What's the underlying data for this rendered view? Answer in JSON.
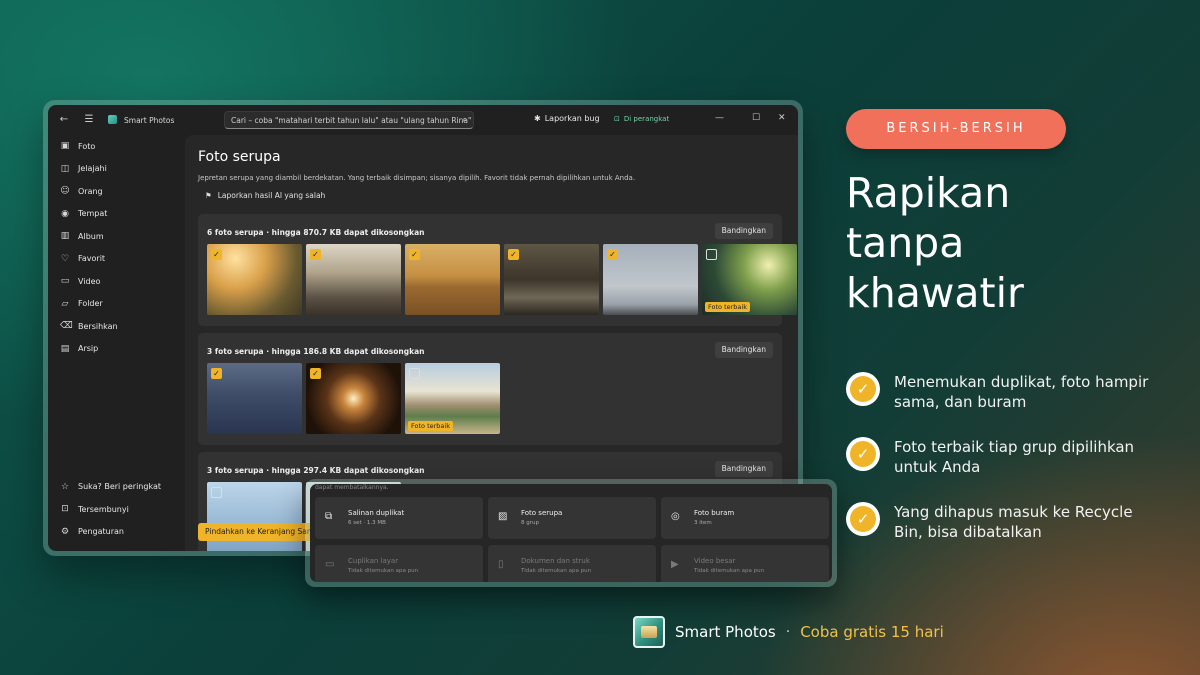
{
  "window": {
    "app_title": "Smart Photos",
    "search_placeholder": "Cari – coba \"matahari terbit tahun lalu\" atau \"ulang tahun Rina\"",
    "report_bug": "Laporkan bug",
    "device_status": "Di perangkat"
  },
  "sidebar": {
    "items": [
      {
        "label": "Foto",
        "icon": "photo-icon"
      },
      {
        "label": "Jelajahi",
        "icon": "explore-icon"
      },
      {
        "label": "Orang",
        "icon": "people-icon"
      },
      {
        "label": "Tempat",
        "icon": "place-icon"
      },
      {
        "label": "Album",
        "icon": "album-icon"
      },
      {
        "label": "Favorit",
        "icon": "heart-icon"
      },
      {
        "label": "Video",
        "icon": "video-icon"
      },
      {
        "label": "Folder",
        "icon": "folder-icon"
      },
      {
        "label": "Bersihkan",
        "icon": "trash-icon"
      },
      {
        "label": "Arsip",
        "icon": "archive-icon"
      }
    ],
    "bottom": [
      {
        "label": "Suka? Beri peringkat",
        "icon": "star-icon"
      },
      {
        "label": "Tersembunyi",
        "icon": "lock-icon"
      },
      {
        "label": "Pengaturan",
        "icon": "gear-icon"
      }
    ]
  },
  "main": {
    "title": "Foto serupa",
    "subtitle": "Jepretan serupa yang diambil berdekatan. Yang terbaik disimpan; sisanya dipilih. Favorit tidak pernah dipilihkan untuk Anda.",
    "report_ai": "Laporkan hasil AI yang salah",
    "compare_label": "Bandingkan",
    "best_label": "Foto terbaik",
    "move_button": "Pindahkan ke Keranjang Sampah",
    "groups": [
      {
        "title": "6 foto serupa · hingga 870.7 KB dapat dikosongkan"
      },
      {
        "title": "3 foto serupa · hingga 186.8 KB dapat dikosongkan"
      },
      {
        "title": "3 foto serupa · hingga 297.4 KB dapat dikosongkan"
      }
    ]
  },
  "panel": {
    "peek_text": "dapat membatalkannya.",
    "tiles": [
      {
        "title": "Salinan duplikat",
        "sub": "6 set · 1.3 MB",
        "icon": "copy-icon"
      },
      {
        "title": "Foto serupa",
        "sub": "8 grup",
        "icon": "image-icon"
      },
      {
        "title": "Foto buram",
        "sub": "3 item",
        "icon": "eye-icon"
      },
      {
        "title": "Cuplikan layar",
        "sub": "Tidak ditemukan apa pun",
        "icon": "monitor-icon"
      },
      {
        "title": "Dokumen dan struk",
        "sub": "Tidak ditemukan apa pun",
        "icon": "document-icon"
      },
      {
        "title": "Video besar",
        "sub": "Tidak ditemukan apa pun",
        "icon": "video-icon"
      }
    ]
  },
  "promo": {
    "badge": "BERSIH-BERSIH",
    "headline_lines": [
      "Rapikan",
      "tanpa",
      "khawatir"
    ],
    "features": [
      "Menemukan duplikat, foto hampir sama, dan buram",
      "Foto terbaik tiap grup dipilihkan untuk Anda",
      "Yang dihapus masuk ke Recycle Bin, bisa dibatalkan"
    ],
    "footer_name": "Smart Photos",
    "footer_sep": "·",
    "footer_cta": "Coba gratis 15 hari"
  },
  "colors": {
    "accent": "#f0b429",
    "badge": "#f0705a",
    "device_green": "#6fd3a8"
  }
}
